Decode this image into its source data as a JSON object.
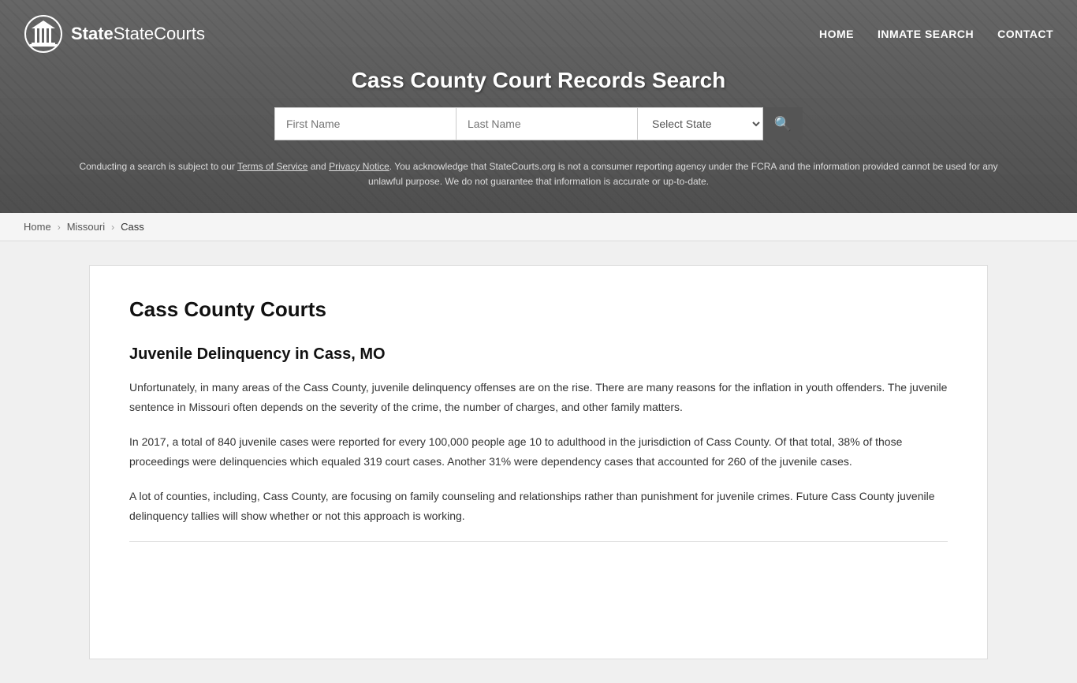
{
  "site": {
    "name": "StateCourts",
    "logo_alt": "StateCourts logo"
  },
  "nav": {
    "home_label": "HOME",
    "inmate_search_label": "INMATE SEARCH",
    "contact_label": "CONTACT"
  },
  "header": {
    "title": "Cass County Court Records Search",
    "search": {
      "first_name_placeholder": "First Name",
      "last_name_placeholder": "Last Name",
      "state_placeholder": "Select State",
      "search_icon": "🔍"
    },
    "disclaimer": "Conducting a search is subject to our Terms of Service and Privacy Notice. You acknowledge that StateCourts.org is not a consumer reporting agency under the FCRA and the information provided cannot be used for any unlawful purpose. We do not guarantee that information is accurate or up-to-date."
  },
  "breadcrumb": {
    "home": "Home",
    "state": "Missouri",
    "county": "Cass"
  },
  "content": {
    "page_title": "Cass County Courts",
    "section1_title": "Juvenile Delinquency in Cass, MO",
    "para1": "Unfortunately, in many areas of the Cass County, juvenile delinquency offenses are on the rise. There are many reasons for the inflation in youth offenders. The juvenile sentence in Missouri often depends on the severity of the crime, the number of charges, and other family matters.",
    "para2": "In 2017, a total of 840 juvenile cases were reported for every 100,000 people age 10 to adulthood in the jurisdiction of Cass County. Of that total, 38% of those proceedings were delinquencies which equaled 319 court cases. Another 31% were dependency cases that accounted for 260 of the juvenile cases.",
    "para3": "A lot of counties, including, Cass County, are focusing on family counseling and relationships rather than punishment for juvenile crimes. Future Cass County juvenile delinquency tallies will show whether or not this approach is working."
  }
}
